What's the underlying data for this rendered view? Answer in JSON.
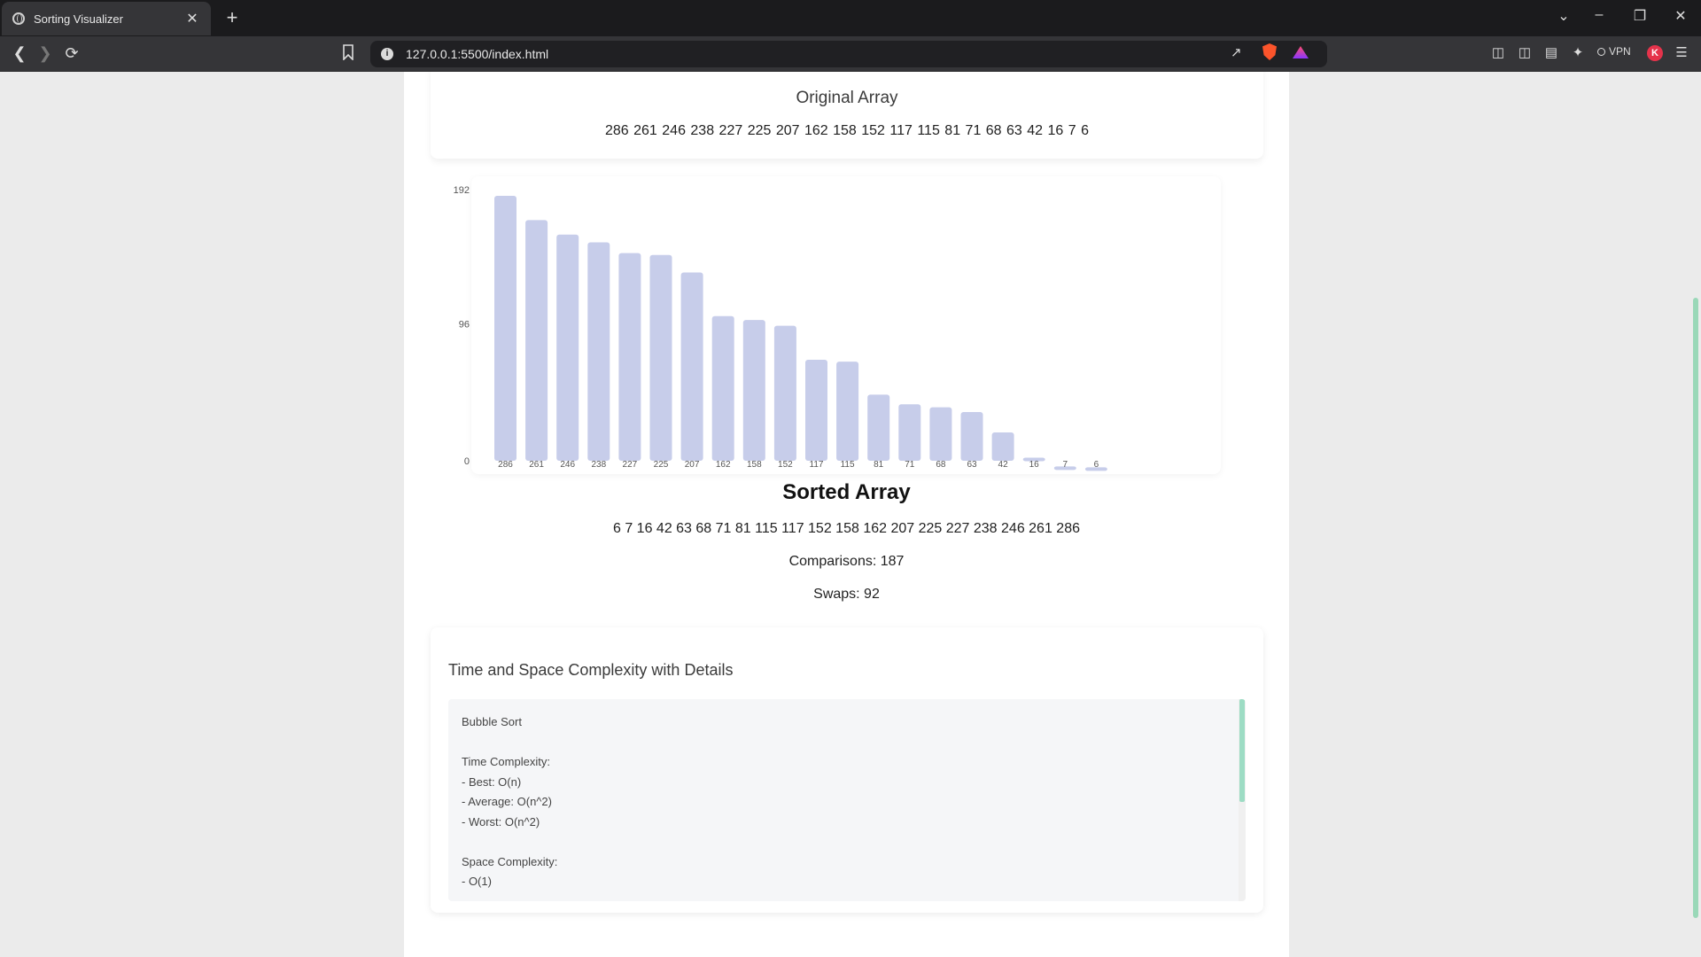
{
  "browser": {
    "tab_title": "Sorting Visualizer",
    "tab_close": "✕",
    "new_tab": "+",
    "url": "127.0.0.1:5500/index.html",
    "vpn_label": "VPN",
    "profile_initial": "K",
    "icons": {
      "back": "back-arrow-icon",
      "forward": "forward-arrow-icon",
      "reload": "reload-icon",
      "bookmark": "bookmark-icon",
      "info": "info-icon",
      "share": "share-icon",
      "brave": "brave-shield-icon",
      "rewards": "brave-rewards-icon",
      "extensions": "puzzle-icon",
      "sidebar": "sidebar-icon",
      "wallet": "wallet-icon",
      "leo": "sparkle-icon",
      "menu": "hamburger-menu-icon"
    }
  },
  "original": {
    "title": "Original Array",
    "array_text": "286 261 246 238 227 225 207 162 158 152 117 115 81 71 68 63 42 16 7 6"
  },
  "chart_data": {
    "type": "bar",
    "categories": [
      "286",
      "261",
      "246",
      "238",
      "227",
      "225",
      "207",
      "162",
      "158",
      "152",
      "117",
      "115",
      "81",
      "71",
      "68",
      "63",
      "42",
      "16",
      "7",
      "6"
    ],
    "values": [
      286,
      261,
      246,
      238,
      227,
      225,
      207,
      162,
      158,
      152,
      117,
      115,
      81,
      71,
      68,
      63,
      42,
      16,
      7,
      6
    ],
    "yticks": [
      "0",
      "96",
      "192"
    ],
    "ylim": [
      0,
      192
    ],
    "title": "",
    "xlabel": "",
    "ylabel": "",
    "bar_color": "#c7cdea",
    "grid": false
  },
  "sorted": {
    "title": "Sorted Array",
    "array_text": "6 7 16 42 63 68 71 81 115 117 152 158 162 207 225 227 238 246 261 286",
    "comparisons": "Comparisons: 187",
    "swaps": "Swaps: 92"
  },
  "complexity": {
    "title": "Time and Space Complexity with Details",
    "details": "Bubble Sort\n\nTime Complexity:\n- Best: O(n)\n- Average: O(n^2)\n- Worst: O(n^2)\n\nSpace Complexity:\n- O(1)"
  }
}
